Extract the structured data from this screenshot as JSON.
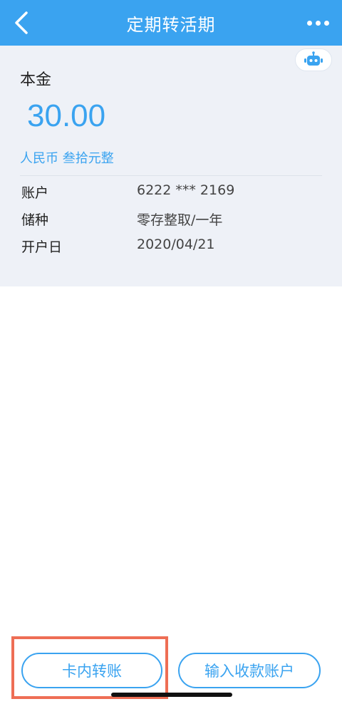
{
  "header": {
    "title": "定期转活期",
    "back_icon": "chevron-left-icon",
    "more_icon": "more-dots-icon"
  },
  "assistant": {
    "icon": "robot-icon"
  },
  "deposit": {
    "principal_label": "本金",
    "amount": "30.00",
    "amount_words": "人民币 叁拾元整",
    "details": [
      {
        "label": "账户",
        "value": "6222 *** 2169"
      },
      {
        "label": "储种",
        "value": "零存整取/一年"
      },
      {
        "label": "开户日",
        "value": "2020/04/21"
      }
    ]
  },
  "actions": {
    "card_transfer_label": "卡内转账",
    "enter_account_label": "输入收款账户"
  },
  "colors": {
    "accent": "#3aa3f0",
    "card_bg": "#eef1f7",
    "highlight": "#ee6e55"
  }
}
